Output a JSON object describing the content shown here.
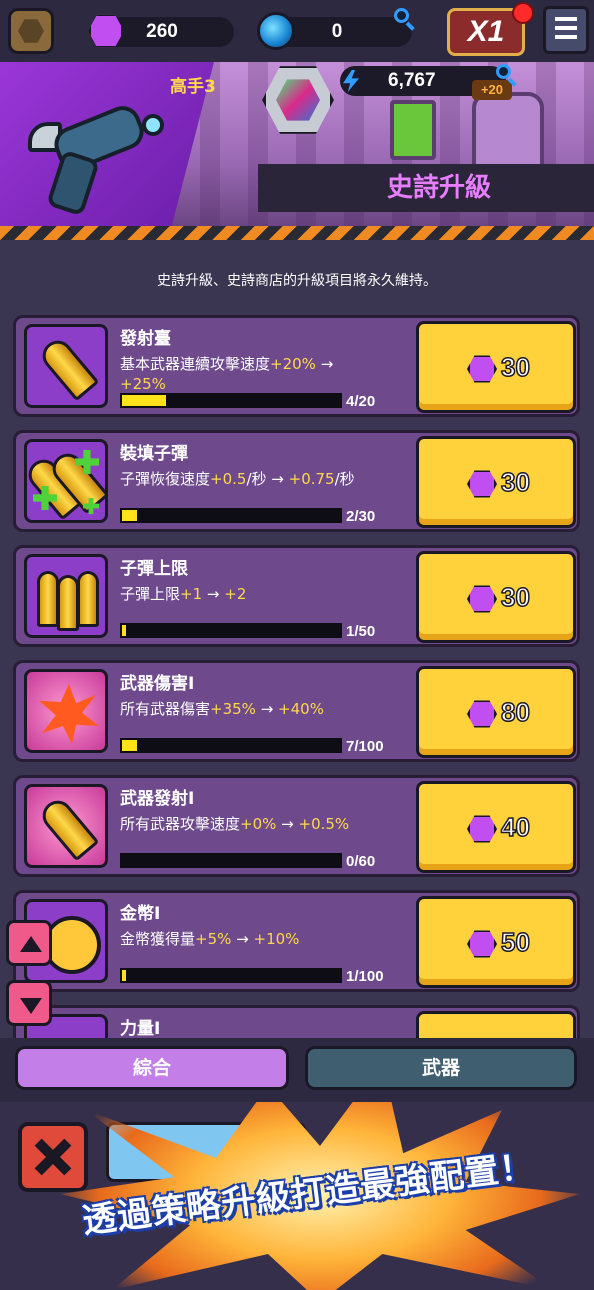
{
  "top_bar": {
    "gems": "260",
    "orbs": "0",
    "speed_label": "X1"
  },
  "header": {
    "rank": "高手3",
    "energy": "6,767",
    "energy_bonus": "+20",
    "title": "史詩升級"
  },
  "notice": "史詩升級、史詩商店的升級項目將永久維持。",
  "upgrades": [
    {
      "name": "發射臺",
      "desc_pre": "基本武器連續攻擊速度",
      "from": "+20%",
      "arrow": " → ",
      "to": "+25%",
      "progress": "4/20",
      "fill": 0.2,
      "price": "30",
      "icon": "bullet-icon"
    },
    {
      "name": "裝填子彈",
      "desc_pre": "子彈恢復速度",
      "from": "+0.5",
      "unit1": "/秒",
      "arrow": " → ",
      "to": "+0.75",
      "unit2": "/秒",
      "progress": "2/30",
      "fill": 0.067,
      "price": "30",
      "icon": "reload-bullets-icon"
    },
    {
      "name": "子彈上限",
      "desc_pre": "子彈上限",
      "from": "+1",
      "arrow": " → ",
      "to": "+2",
      "progress": "1/50",
      "fill": 0.02,
      "price": "30",
      "icon": "ammo-capacity-icon"
    },
    {
      "name": "武器傷害I",
      "desc_pre": "所有武器傷害",
      "from": "+35%",
      "arrow": " → ",
      "to": "+40%",
      "progress": "7/100",
      "fill": 0.07,
      "price": "80",
      "icon": "damage-burst-icon"
    },
    {
      "name": "武器發射I",
      "desc_pre": "所有武器攻擊速度",
      "from": "+0%",
      "arrow": " → ",
      "to": "+0.5%",
      "progress": "0/60",
      "fill": 0,
      "price": "40",
      "icon": "fire-rate-icon"
    },
    {
      "name": "金幣I",
      "desc_pre": "金幣獲得量",
      "from": "+5%",
      "arrow": " → ",
      "to": "+10%",
      "progress": "1/100",
      "fill": 0.01,
      "price": "50",
      "icon": "gold-coin-icon"
    },
    {
      "name": "力量I"
    }
  ],
  "tabs": {
    "general": "綜合",
    "weapon": "武器"
  },
  "promo": {
    "text": "透過策略升級打造最強配置！"
  },
  "colors": {
    "accent_purple": "#c37ee8",
    "button_yellow": "#ffd23c",
    "highlight_value": "#ffd84a",
    "progress_fill": "#ffe21a"
  }
}
